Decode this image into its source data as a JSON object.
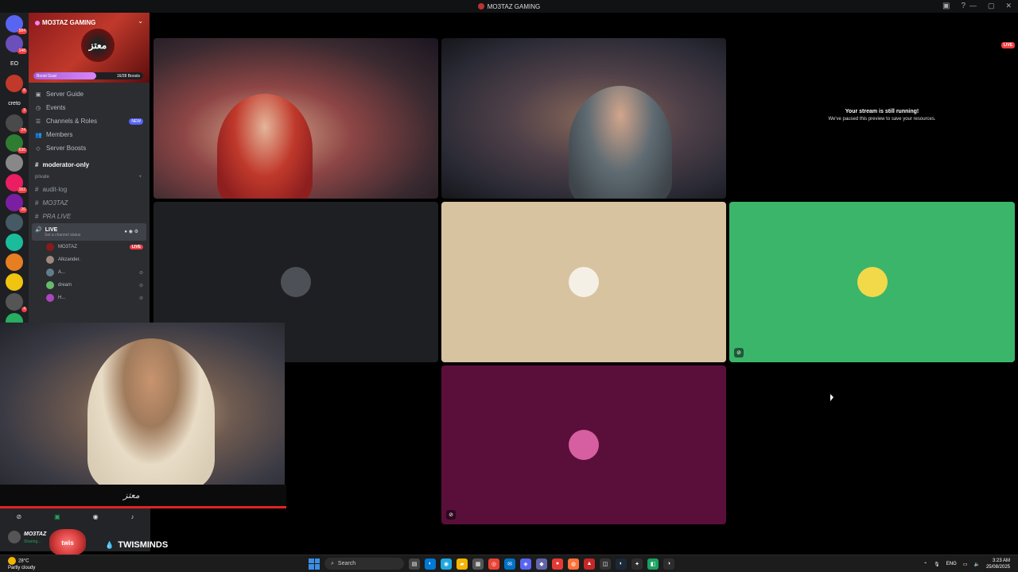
{
  "window": {
    "title": "MO3TAZ GAMING"
  },
  "rail": {
    "items": [
      {
        "label": "",
        "badge": "584",
        "color": "#5865f2"
      },
      {
        "label": "",
        "badge": "148",
        "color": "#6b4fbb"
      },
      {
        "label": "EO",
        "badge": "",
        "color": "#1e1f22"
      },
      {
        "label": "",
        "badge": "8",
        "color": "#c0392b"
      },
      {
        "label": "creto",
        "badge": "3",
        "color": "#1e1f22"
      },
      {
        "label": "",
        "badge": "24",
        "color": "#4a4a4a"
      },
      {
        "label": "",
        "badge": "636",
        "color": "#2e7d32"
      },
      {
        "label": "",
        "badge": "",
        "color": "#888888"
      },
      {
        "label": "",
        "badge": "162",
        "color": "#e91e63"
      },
      {
        "label": "",
        "badge": "26",
        "color": "#7b1fa2"
      },
      {
        "label": "",
        "badge": "",
        "color": "#455a64"
      },
      {
        "label": "",
        "badge": "",
        "color": "#1abc9c"
      },
      {
        "label": "",
        "badge": "",
        "color": "#e67e22"
      },
      {
        "label": "",
        "badge": "",
        "color": "#f1c40f"
      },
      {
        "label": "",
        "badge": "4",
        "color": "#555555"
      },
      {
        "label": "",
        "badge": "31",
        "color": "#27ae60"
      }
    ]
  },
  "sidebar": {
    "server_name": "MO3TAZ GAMING",
    "banner_logo": "معتز",
    "boost_goal": "Boost Goal",
    "boost_count": "16/28 Boosts",
    "boost_progress": 0.57,
    "nav": [
      {
        "icon": "▣",
        "label": "Server Guide",
        "new": ""
      },
      {
        "icon": "◷",
        "label": "Events",
        "new": ""
      },
      {
        "icon": "☰",
        "label": "Channels & Roles",
        "new": "NEW"
      },
      {
        "icon": "👥",
        "label": "Members",
        "new": ""
      },
      {
        "icon": "◇",
        "label": "Server Boosts",
        "new": ""
      }
    ],
    "channel_moderator": "moderator-only",
    "category_private": "private",
    "channels": [
      "audit-log",
      "MO3TAZ",
      "PRA LIVE"
    ],
    "live_channel": "LIVE",
    "live_channel_status": "Set a channel status",
    "members": [
      {
        "name": "MO3TAZ",
        "tag": "LIVE",
        "color": "#8b1a1a"
      },
      {
        "name": "Alkzander.",
        "tag": "",
        "color": "#a1887f"
      },
      {
        "name": "A...",
        "tag": "",
        "color": "#607d8b"
      },
      {
        "name": "dream",
        "tag": "",
        "color": "#66bb6a"
      },
      {
        "name": "H...",
        "tag": "",
        "color": "#ab47bc"
      }
    ]
  },
  "stream": {
    "live_badge": "LIVE",
    "paused_title": "Your stream is still running!",
    "paused_text": "We've paused this preview to save your resources."
  },
  "tiles": [
    {
      "bg": "#1e1f22",
      "avatar_color": "#4e5058"
    },
    {
      "bg": "#d8c3a0",
      "avatar_color": "#f5f0e6"
    },
    {
      "bg": "#3bb56a",
      "avatar_color": "#f2d94a"
    },
    {
      "bg": "#5a0f3a",
      "avatar_color": "#d55fa0"
    }
  ],
  "webcam": {
    "signature": "معتز"
  },
  "user": {
    "name": "MO3TAZ",
    "status": "Sharing..."
  },
  "overlay": {
    "brand": "TWISMINDS",
    "logo_text": "twis"
  },
  "taskbar": {
    "weather_temp": "28°C",
    "weather_desc": "Partly cloudy",
    "search": "Search",
    "lang": "ENG",
    "time": "3:23 AM",
    "date": "25/08/2025",
    "apps": [
      {
        "icon": "▤",
        "color": "#444444"
      },
      {
        "icon": "◐",
        "color": "#0078d4"
      },
      {
        "icon": "◉",
        "color": "#1fa8e0"
      },
      {
        "icon": "▰",
        "color": "#f4b400"
      },
      {
        "icon": "▦",
        "color": "#555555"
      },
      {
        "icon": "◎",
        "color": "#ea4335"
      },
      {
        "icon": "✉",
        "color": "#0072c6"
      },
      {
        "icon": "◈",
        "color": "#5865f2"
      },
      {
        "icon": "◆",
        "color": "#6264a7"
      },
      {
        "icon": "●",
        "color": "#e53935"
      },
      {
        "icon": "◍",
        "color": "#ff7139"
      },
      {
        "icon": "▲",
        "color": "#c62828"
      },
      {
        "icon": "◫",
        "color": "#333333"
      },
      {
        "icon": "◐",
        "color": "#1b2838"
      },
      {
        "icon": "✦",
        "color": "#2d2d2d"
      },
      {
        "icon": "◧",
        "color": "#1aa260"
      },
      {
        "icon": "◑",
        "color": "#2d2d2d"
      }
    ]
  }
}
